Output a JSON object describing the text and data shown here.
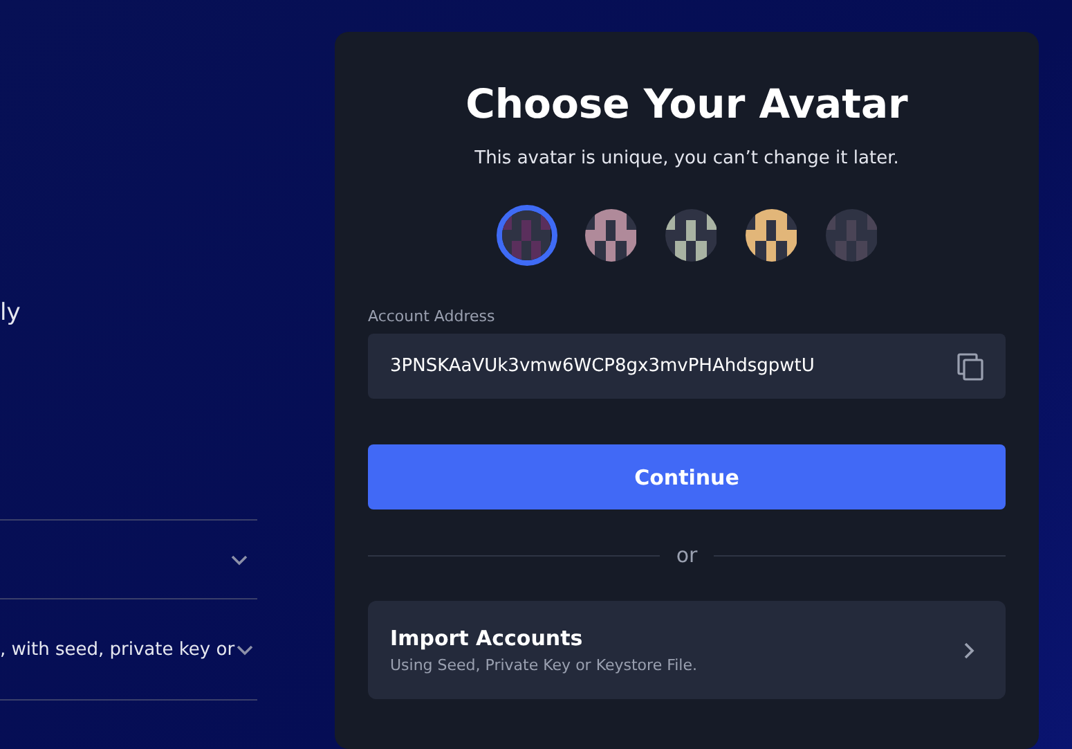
{
  "side_panel": {
    "text_fragment": "ly",
    "faq": [
      {
        "expanded": false
      },
      {
        "question": ", with seed, private key or",
        "expanded": false
      }
    ]
  },
  "card": {
    "title": "Choose Your Avatar",
    "subtitle": "This avatar is unique, you can’t change it later.",
    "avatars": [
      {
        "selected": true,
        "color": "#5a2f5c"
      },
      {
        "selected": false,
        "color": "#b08a9a"
      },
      {
        "selected": false,
        "color": "#a9b3a3"
      },
      {
        "selected": false,
        "color": "#e2b679"
      },
      {
        "selected": false,
        "color": "#4a4456"
      }
    ],
    "address_label": "Account Address",
    "address": "3PNSKAaVUk3vmw6WCP8gx3mvPHAhdsgpwtU",
    "continue_button": "Continue",
    "divider_text": "or",
    "import": {
      "title": "Import Accounts",
      "subtitle": "Using Seed, Private Key or Keystore File."
    }
  }
}
